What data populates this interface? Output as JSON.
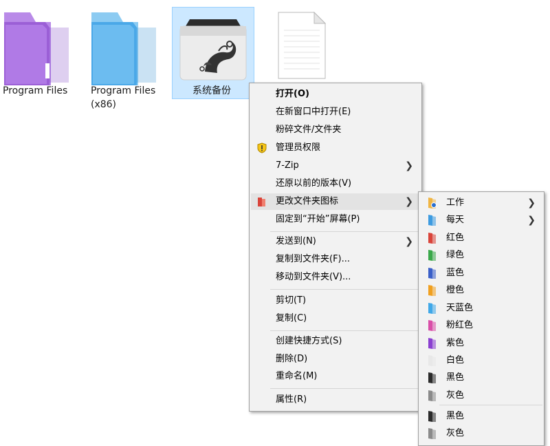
{
  "desktop": {
    "items": [
      {
        "label": "Program Files",
        "color": "#9b5fd6"
      },
      {
        "label": "Program Files",
        "label2": "(x86)",
        "color": "#4aa8e8"
      },
      {
        "label": "系统备份",
        "selected": true
      },
      {
        "label": "",
        "type": "blank-file"
      }
    ]
  },
  "context_menu": {
    "items": [
      {
        "label": "打开(O)",
        "bold": true
      },
      {
        "label": "在新窗口中打开(E)"
      },
      {
        "label": "粉碎文件/文件夹"
      },
      {
        "label": "管理员权限",
        "icon": "shield-icon"
      },
      {
        "label": "7-Zip",
        "submenu": true
      },
      {
        "label": "还原以前的版本(V)"
      },
      {
        "label": "更改文件夹图标",
        "submenu": true,
        "highlighted": true,
        "icon": "folder-icon"
      },
      {
        "label": "固定到“开始”屏幕(P)"
      },
      {
        "label": "发送到(N)",
        "submenu": true
      },
      {
        "label": "复制到文件夹(F)..."
      },
      {
        "label": "移动到文件夹(V)..."
      },
      {
        "label": "剪切(T)"
      },
      {
        "label": "复制(C)"
      },
      {
        "label": "创建快捷方式(S)"
      },
      {
        "label": "删除(D)"
      },
      {
        "label": "重命名(M)"
      },
      {
        "label": "属性(R)"
      }
    ]
  },
  "submenu": {
    "items": [
      {
        "label": "工作",
        "color": "#f0b542",
        "submenu": true
      },
      {
        "label": "每天",
        "color": "#3d9be0",
        "submenu": true
      },
      {
        "label": "红色",
        "color": "#d9443a"
      },
      {
        "label": "绿色",
        "color": "#3aa84a"
      },
      {
        "label": "蓝色",
        "color": "#3a5fc8"
      },
      {
        "label": "橙色",
        "color": "#f0a020"
      },
      {
        "label": "天蓝色",
        "color": "#40a8e8"
      },
      {
        "label": "粉红色",
        "color": "#d94fa8"
      },
      {
        "label": "紫色",
        "color": "#8a3fd0"
      },
      {
        "label": "白色",
        "color": "#e8e8e8"
      },
      {
        "label": "黑色",
        "color": "#2a2a2a"
      },
      {
        "label": "灰色",
        "color": "#8a8a8a"
      },
      {
        "label": "黑色",
        "color": "#2a2a2a"
      },
      {
        "label": "灰色",
        "color": "#8a8a8a"
      }
    ]
  }
}
